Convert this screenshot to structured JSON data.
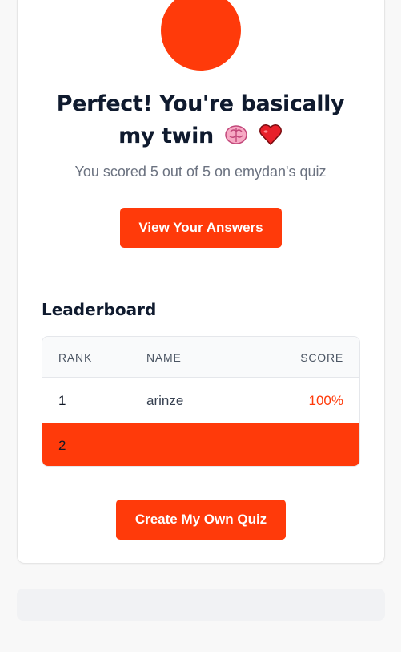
{
  "result": {
    "title_line1": "Perfect! You're basically",
    "title_line2": "my twin",
    "emojis": [
      "brain-icon",
      "red-heart-icon"
    ],
    "subtitle": "You scored 5 out of 5 on emydan's quiz",
    "view_answers_label": "View Your Answers"
  },
  "leaderboard": {
    "title": "Leaderboard",
    "columns": [
      "RANK",
      "NAME",
      "SCORE"
    ],
    "rows": [
      {
        "rank": "1",
        "name": "arinze",
        "score": "100%"
      },
      {
        "rank": "2",
        "name": "",
        "score": ""
      }
    ]
  },
  "create_quiz_label": "Create My Own Quiz",
  "colors": {
    "accent": "#ff3a0a",
    "heading": "#0f1a2e",
    "muted": "#6b7280"
  }
}
